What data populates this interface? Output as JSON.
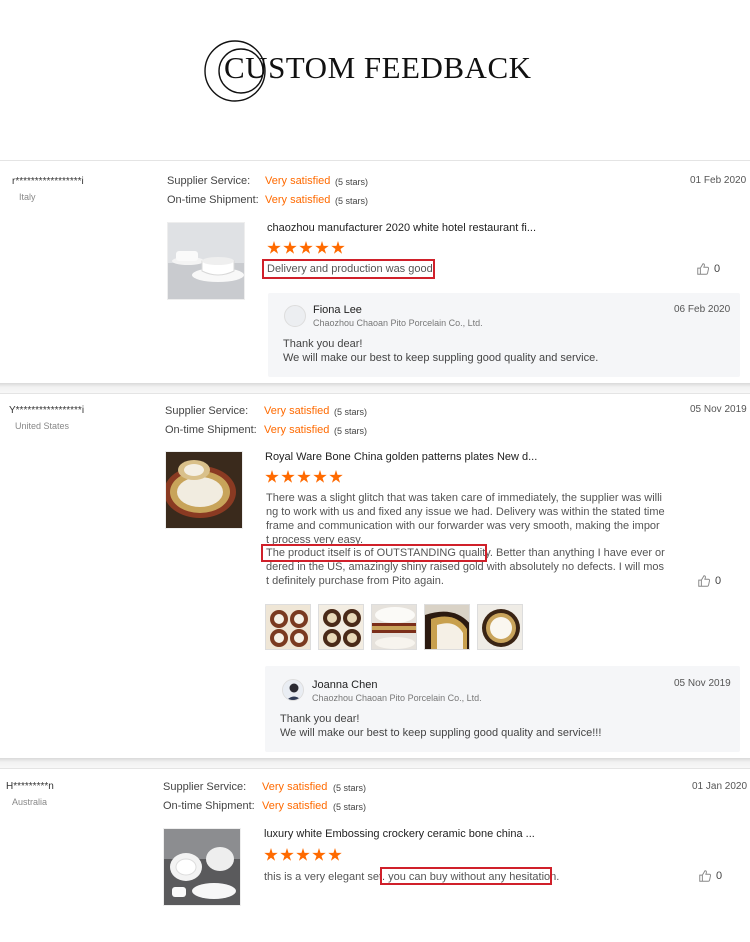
{
  "page": {
    "title": "CUSTOM FEEDBACK"
  },
  "labels": {
    "supplier_service": "Supplier Service:",
    "on_time_shipment": "On-time Shipment:"
  },
  "colors": {
    "accent": "#ff6a00",
    "highlight": "#d0202a",
    "reply_bg": "#f5f6f8"
  },
  "reviews": [
    {
      "buyer": "r*****************i",
      "country": "Italy",
      "supplier_service": {
        "value": "Very satisfied",
        "stars": "(5 stars)"
      },
      "on_time_shipment": {
        "value": "Very satisfied",
        "stars": "(5 stars)"
      },
      "date": "01 Feb 2020",
      "product_title": "chaozhou manufacturer 2020 white hotel restaurant fi...",
      "rating": 5,
      "text": "Delivery and production was good",
      "likes": "0",
      "reply": {
        "name": "Fiona Lee",
        "company": "Chaozhou Chaoan Pito Porcelain Co., Ltd.",
        "date": "06 Feb 2020",
        "line1": "Thank you dear!",
        "line2": "We will make our best to keep suppling good quality and service."
      }
    },
    {
      "buyer": "Y*****************i",
      "country": "United States",
      "supplier_service": {
        "value": "Very satisfied",
        "stars": "(5 stars)"
      },
      "on_time_shipment": {
        "value": "Very satisfied",
        "stars": "(5 stars)"
      },
      "date": "05 Nov 2019",
      "product_title": "Royal Ware Bone China golden patterns plates New d...",
      "rating": 5,
      "text_lines": [
        "There was a slight glitch that was taken care of immediately, the supplier was willi",
        "ng to work with us and fixed any issue we had. Delivery was within the stated time",
        "frame and communication with our forwarder was very smooth, making the impor",
        "t process very easy.",
        "The product itself is of OUTSTANDING quality. Better than anything I have ever or",
        "dered in the US, amazingly shiny raised gold with absolutely no defects. I will mos",
        "t definitely purchase from Pito again."
      ],
      "likes": "0",
      "gallery_count": 5,
      "reply": {
        "name": "Joanna Chen",
        "company": "Chaozhou Chaoan Pito Porcelain Co., Ltd.",
        "date": "05 Nov 2019",
        "line1": "Thank you dear!",
        "line2": "We will make our best to keep suppling good quality and service!!!"
      }
    },
    {
      "buyer": "H*********n",
      "country": "Australia",
      "supplier_service": {
        "value": "Very satisfied",
        "stars": "(5 stars)"
      },
      "on_time_shipment": {
        "value": "Very satisfied",
        "stars": "(5 stars)"
      },
      "date": "01 Jan 2020",
      "product_title": "luxury white Embossing crockery ceramic bone china ...",
      "rating": 5,
      "text_part1": "this is a very elegant set.",
      "text_part2": "you can buy without any hesitation.",
      "likes": "0"
    }
  ]
}
